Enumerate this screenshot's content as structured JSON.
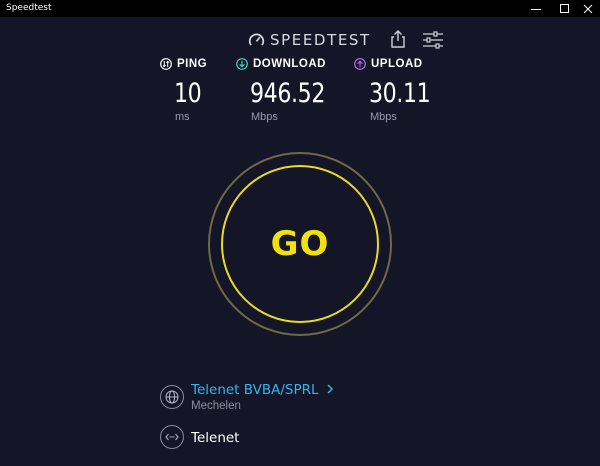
{
  "window": {
    "title": "Speedtest",
    "minimize_icon": "minimize-icon",
    "maximize_icon": "maximize-icon",
    "close_icon": "close-icon"
  },
  "header": {
    "brand": "SPEEDTEST",
    "logo_icon": "speedometer-icon",
    "share_icon": "share-icon",
    "settings_icon": "sliders-icon"
  },
  "metrics": {
    "ping": {
      "label": "PING",
      "value": "10",
      "unit": "ms",
      "color": "#ffffff"
    },
    "download": {
      "label": "DOWNLOAD",
      "value": "946.52",
      "unit": "Mbps",
      "color": "#43d3c7"
    },
    "upload": {
      "label": "UPLOAD",
      "value": "30.11",
      "unit": "Mbps",
      "color": "#b36cf0"
    }
  },
  "go_button": {
    "label": "GO",
    "color": "#f3e10f"
  },
  "provider": {
    "name": "Telenet BVBA/SPRL",
    "location": "Mechelen",
    "icon": "globe-icon"
  },
  "server": {
    "name": "Telenet",
    "icon": "server-arrows-icon"
  }
}
